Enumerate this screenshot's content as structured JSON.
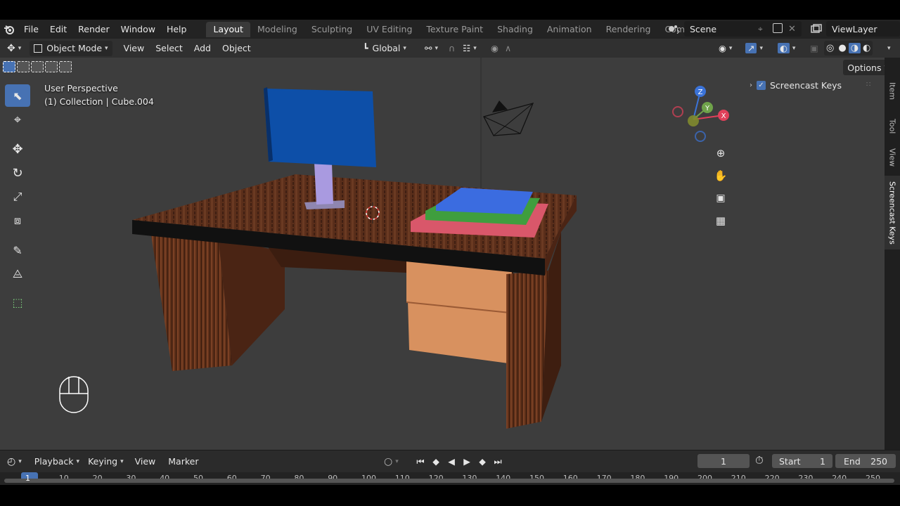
{
  "menus": [
    "File",
    "Edit",
    "Render",
    "Window",
    "Help"
  ],
  "workspaces": [
    "Layout",
    "Modeling",
    "Sculpting",
    "UV Editing",
    "Texture Paint",
    "Shading",
    "Animation",
    "Rendering",
    "Compositing"
  ],
  "scene": {
    "label": "Scene",
    "view_layer": "ViewLayer"
  },
  "header": {
    "mode": "Object Mode",
    "view": "View",
    "select": "Select",
    "add": "Add",
    "object": "Object",
    "orientation": "Global",
    "options": "Options"
  },
  "viewport": {
    "perspective": "User Perspective",
    "collection": "(1) Collection | Cube.004",
    "screencast_label": "Screencast Keys",
    "axes": {
      "x": "X",
      "y": "Y",
      "z": "Z"
    }
  },
  "side_tabs": [
    "Item",
    "Tool",
    "View",
    "Screencast Keys"
  ],
  "timeline": {
    "playback": "Playback",
    "keying": "Keying",
    "view": "View",
    "marker": "Marker",
    "current_frame": "1",
    "start_label": "Start",
    "start_value": "1",
    "end_label": "End",
    "end_value": "250"
  },
  "ruler_ticks": [
    "1",
    "10",
    "20",
    "30",
    "40",
    "50",
    "60",
    "70",
    "80",
    "90",
    "100",
    "110",
    "120",
    "130",
    "140",
    "150",
    "160",
    "170",
    "180",
    "190",
    "200",
    "210",
    "220",
    "230",
    "240",
    "250"
  ],
  "colors": {
    "accent": "#4772b3",
    "viewport_bg": "#3d3d3d"
  }
}
